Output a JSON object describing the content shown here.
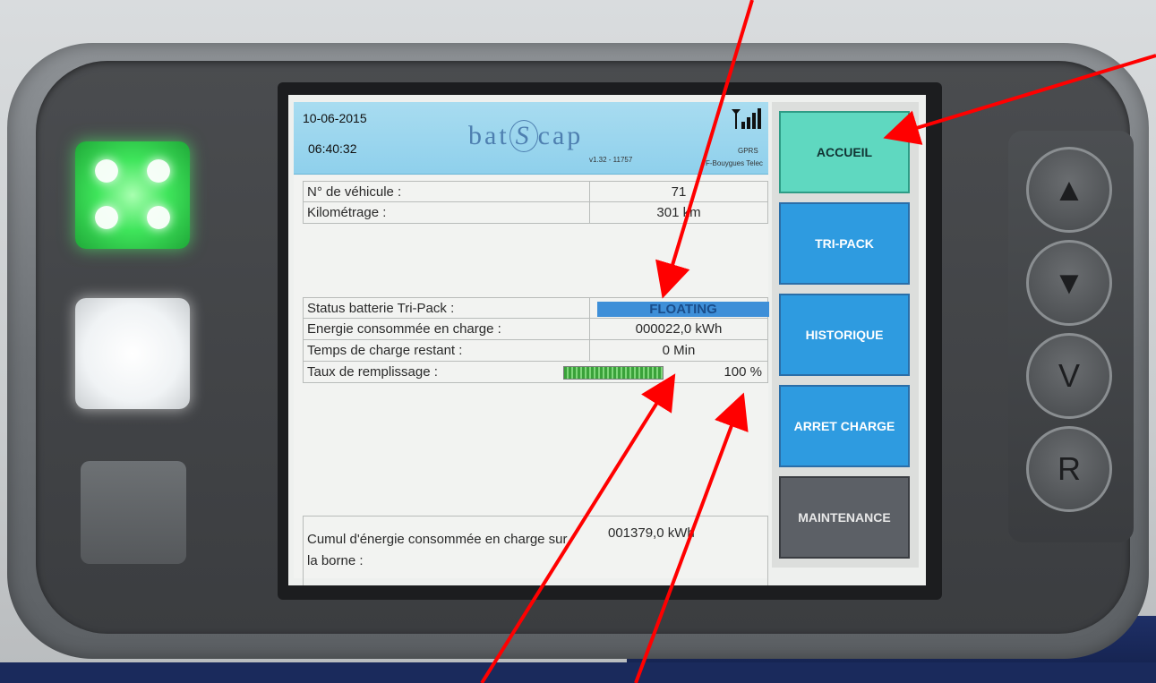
{
  "header": {
    "date": "10-06-2015",
    "time": "06:40:32",
    "logo_left": "bat",
    "logo_mid": "S",
    "logo_right": "cap",
    "version": "v1.32 - 11757",
    "signal_icon": "signal-icon",
    "network_type": "GPRS",
    "operator": "F-Bouygues Telec"
  },
  "rows": {
    "vehicle_label": "N° de véhicule :",
    "vehicle_value": "71",
    "km_label": "Kilométrage :",
    "km_value": "301 km",
    "status_label": "Status batterie Tri-Pack :",
    "status_value": "FLOATING",
    "energy_label": "Energie consommée en charge :",
    "energy_value": "000022,0 kWh",
    "time_left_label": "Temps de charge restant :",
    "time_left_value": "0 Min",
    "fill_label": "Taux de remplissage :",
    "fill_percent_text": "100 %",
    "fill_fraction": 1.0,
    "cumul_label": "Cumul d'énergie consommée en charge sur la borne :",
    "cumul_value": "001379,0 kWh"
  },
  "menu": {
    "accueil": "ACCUEIL",
    "tripack": "TRI-PACK",
    "historique": "HISTORIQUE",
    "arret": "ARRET CHARGE",
    "maintenance": "MAINTENANCE"
  },
  "keys": {
    "up": "▲",
    "down": "▼",
    "v": "V",
    "r": "R"
  },
  "colors": {
    "accent_teal": "#5fd8c0",
    "button_blue": "#2e9be0",
    "status_blue": "#3e8fd8",
    "annotation_red": "#ff0000"
  }
}
